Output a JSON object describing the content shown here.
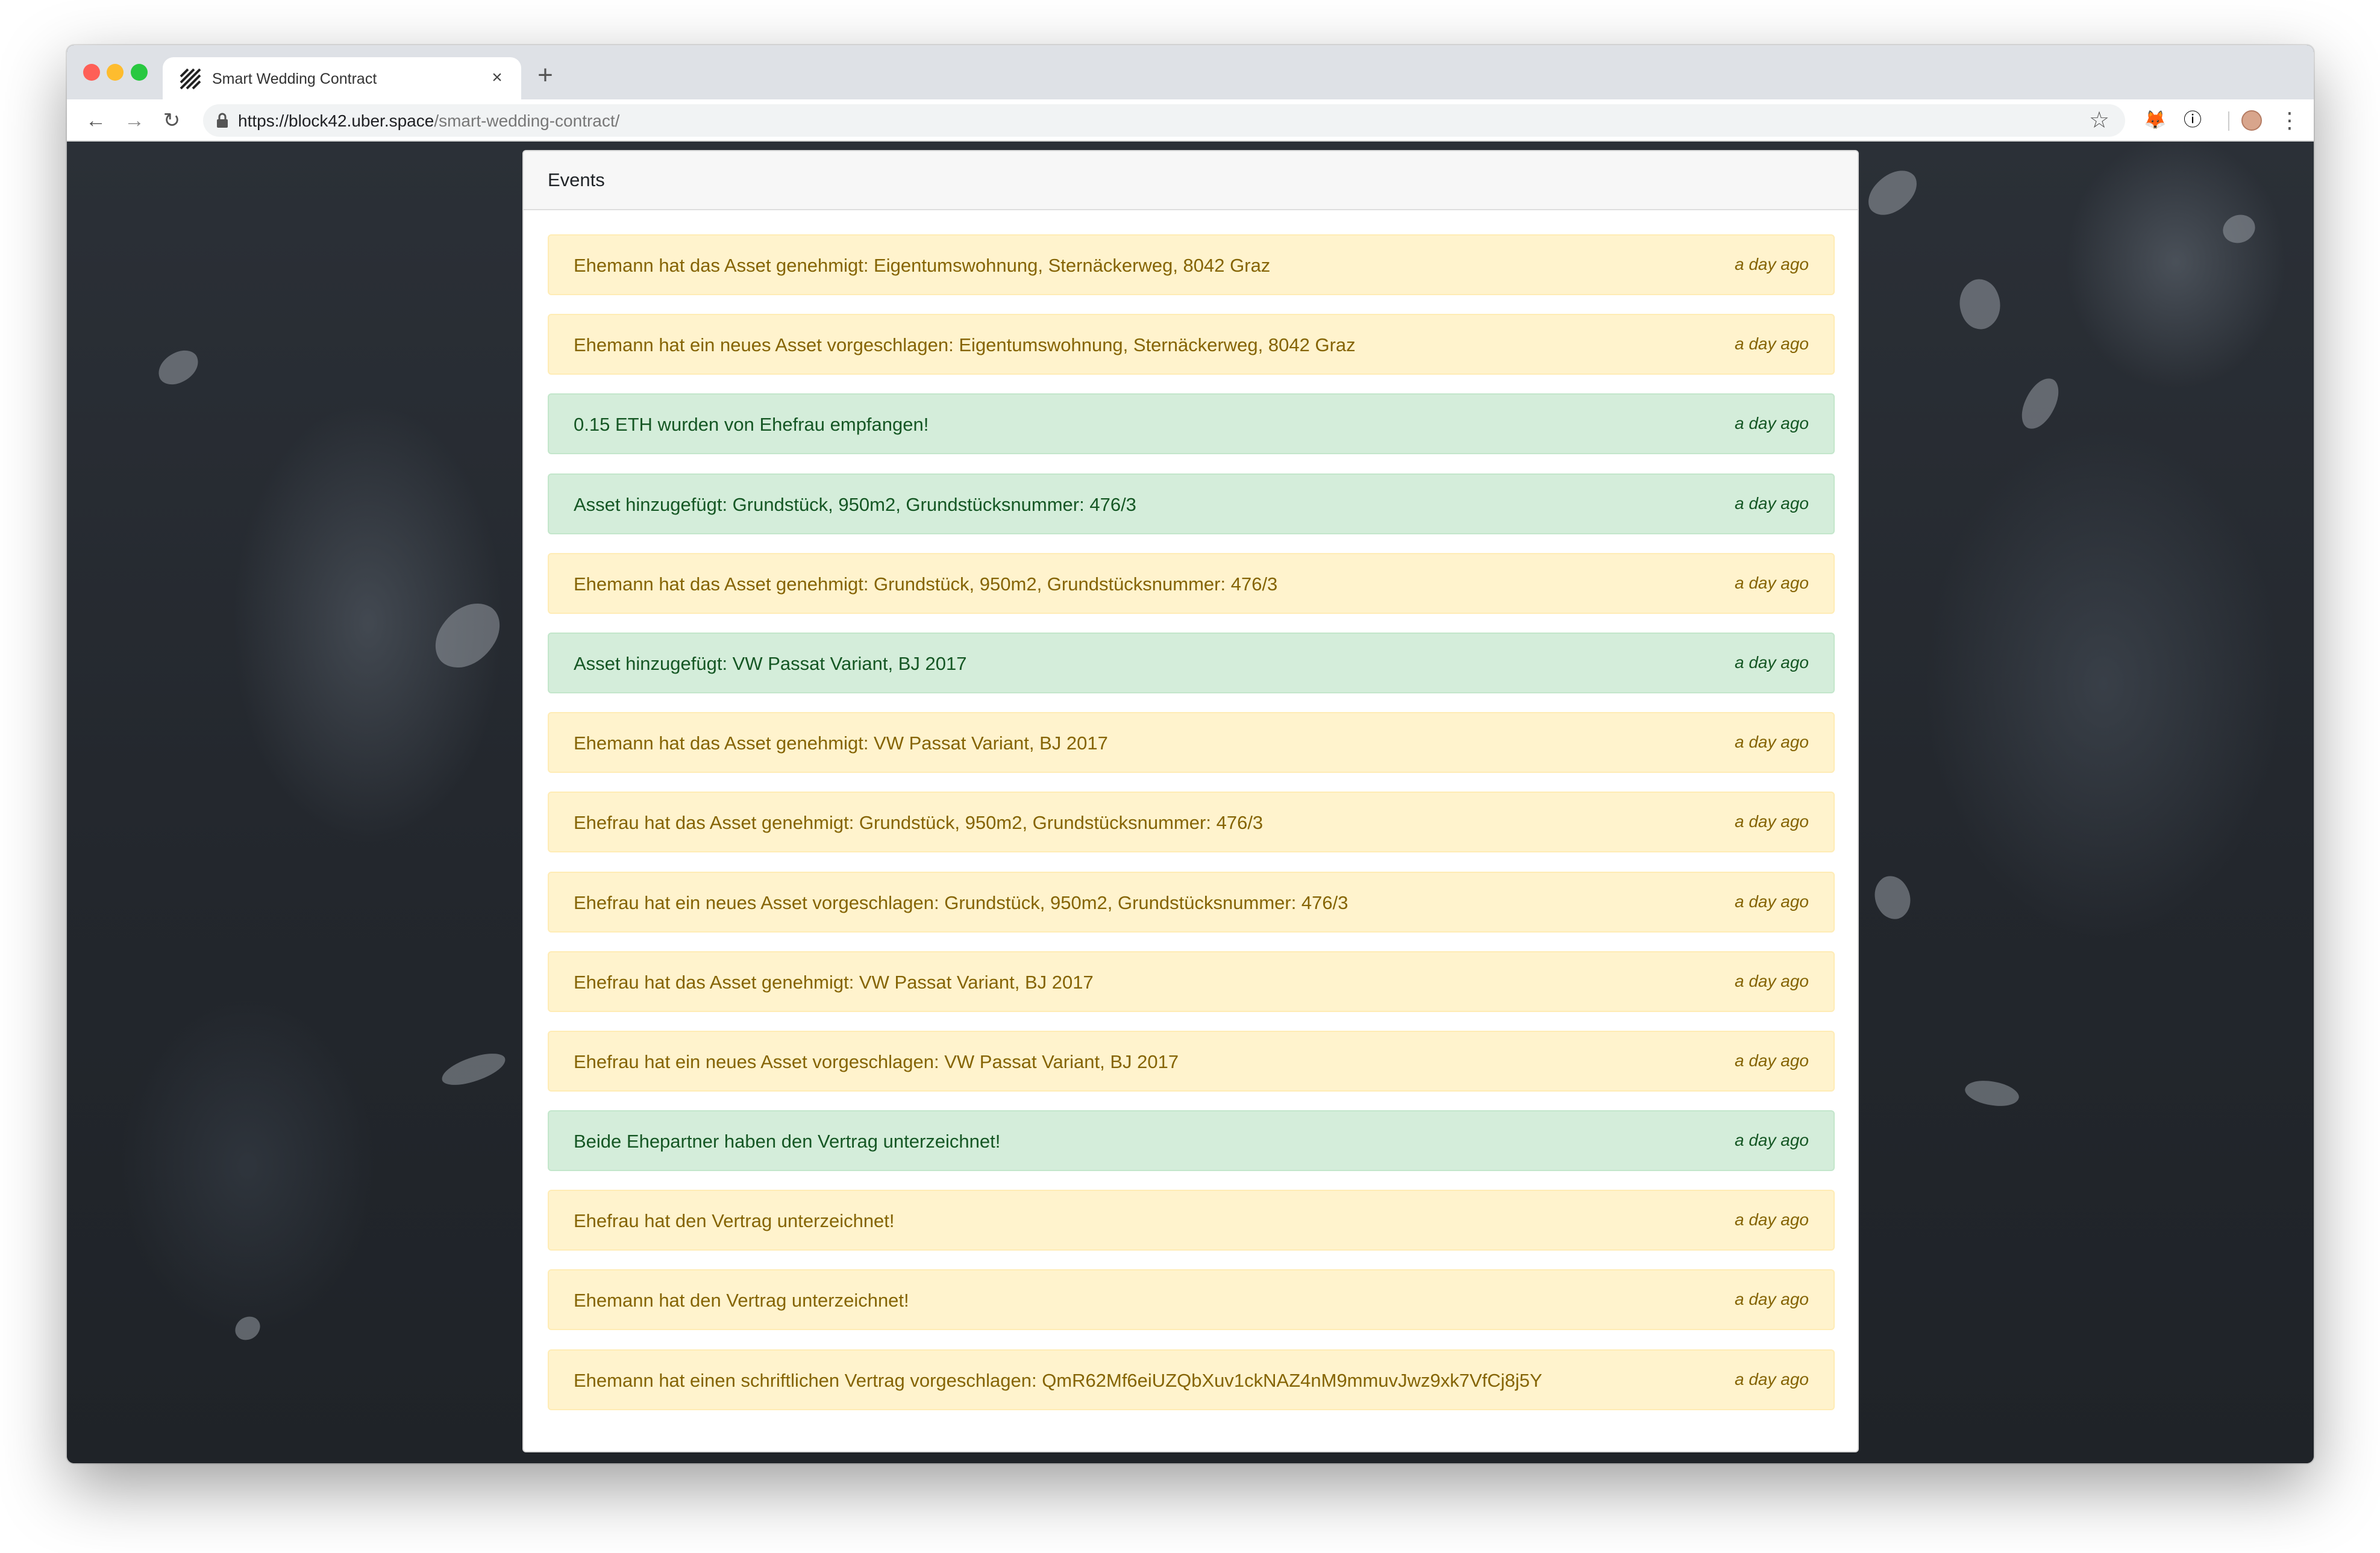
{
  "browser": {
    "tab_title": "Smart Wedding Contract",
    "tab_close": "×",
    "new_tab": "+",
    "url_main": "https://block42.uber.space",
    "url_path": "/smart-wedding-contract/",
    "back_glyph": "←",
    "forward_glyph": "→",
    "reload_glyph": "↻",
    "star_glyph": "☆",
    "menu_glyph": "⋮",
    "info_glyph": "ⓘ",
    "fox_glyph": "🦊"
  },
  "card": {
    "title": "Events"
  },
  "events": [
    {
      "type": "warning",
      "text": "Ehemann hat das Asset genehmigt: Eigentumswohnung, Sternäckerweg, 8042 Graz",
      "time": "a day ago"
    },
    {
      "type": "warning",
      "text": "Ehemann hat ein neues Asset vorgeschlagen: Eigentumswohnung, Sternäckerweg, 8042 Graz",
      "time": "a day ago"
    },
    {
      "type": "success",
      "text": "0.15 ETH wurden von Ehefrau empfangen!",
      "time": "a day ago"
    },
    {
      "type": "success",
      "text": "Asset hinzugefügt: Grundstück, 950m2, Grundstücksnummer: 476/3",
      "time": "a day ago"
    },
    {
      "type": "warning",
      "text": "Ehemann hat das Asset genehmigt: Grundstück, 950m2, Grundstücksnummer: 476/3",
      "time": "a day ago"
    },
    {
      "type": "success",
      "text": "Asset hinzugefügt: VW Passat Variant, BJ 2017",
      "time": "a day ago"
    },
    {
      "type": "warning",
      "text": "Ehemann hat das Asset genehmigt: VW Passat Variant, BJ 2017",
      "time": "a day ago"
    },
    {
      "type": "warning",
      "text": "Ehefrau hat das Asset genehmigt: Grundstück, 950m2, Grundstücksnummer: 476/3",
      "time": "a day ago"
    },
    {
      "type": "warning",
      "text": "Ehefrau hat ein neues Asset vorgeschlagen: Grundstück, 950m2, Grundstücksnummer: 476/3",
      "time": "a day ago"
    },
    {
      "type": "warning",
      "text": "Ehefrau hat das Asset genehmigt: VW Passat Variant, BJ 2017",
      "time": "a day ago"
    },
    {
      "type": "warning",
      "text": "Ehefrau hat ein neues Asset vorgeschlagen: VW Passat Variant, BJ 2017",
      "time": "a day ago"
    },
    {
      "type": "success",
      "text": "Beide Ehepartner haben den Vertrag unterzeichnet!",
      "time": "a day ago"
    },
    {
      "type": "warning",
      "text": "Ehefrau hat den Vertrag unterzeichnet!",
      "time": "a day ago"
    },
    {
      "type": "warning",
      "text": "Ehemann hat den Vertrag unterzeichnet!",
      "time": "a day ago"
    },
    {
      "type": "warning",
      "text": "Ehemann hat einen schriftlichen Vertrag vorgeschlagen: QmR62Mf6eiUZQbXuv1ckNAZ4nM9mmuvJwz9xk7VfCj8j5Y",
      "time": "a day ago"
    }
  ],
  "colors": {
    "warning_bg": "#fff3cd",
    "warning_text": "#856404",
    "success_bg": "#d4edda",
    "success_text": "#155724"
  }
}
